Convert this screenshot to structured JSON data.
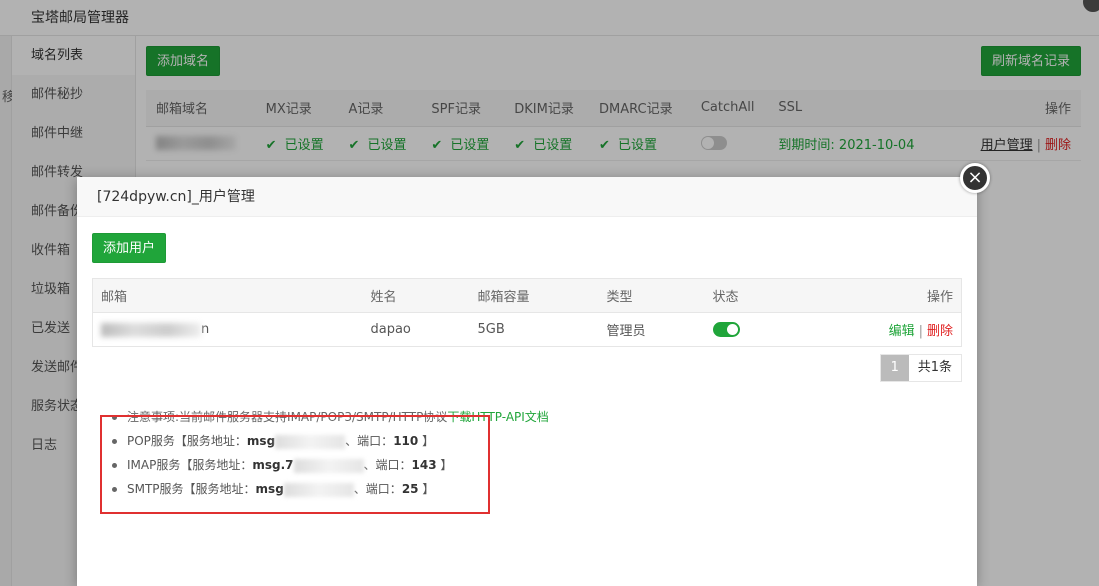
{
  "app": {
    "title": "宝塔邮局管理器",
    "left_stub_label": "移"
  },
  "sidebar": {
    "items": [
      {
        "label": "域名列表"
      },
      {
        "label": "邮件秘抄"
      },
      {
        "label": "邮件中继"
      },
      {
        "label": "邮件转发"
      },
      {
        "label": "邮件备份"
      },
      {
        "label": "收件箱"
      },
      {
        "label": "垃圾箱"
      },
      {
        "label": "已发送"
      },
      {
        "label": "发送邮件"
      },
      {
        "label": "服务状态"
      },
      {
        "label": "日志"
      }
    ]
  },
  "main": {
    "add_domain_label": "添加域名",
    "refresh_label": "刷新域名记录",
    "columns": [
      "邮箱域名",
      "MX记录",
      "A记录",
      "SPF记录",
      "DKIM记录",
      "DMARC记录",
      "CatchAll",
      "SSL",
      "操作"
    ],
    "row": {
      "mx": "已设置",
      "a": "已设置",
      "spf": "已设置",
      "dkim": "已设置",
      "dmarc": "已设置",
      "ssl": "到期时间: 2021-10-04",
      "manage": "用户管理",
      "delete": "删除"
    }
  },
  "modal": {
    "title": "[724dpyw.cn]_用户管理",
    "close_symbol": "×",
    "add_user_label": "添加用户",
    "columns": [
      "邮箱",
      "姓名",
      "邮箱容量",
      "类型",
      "状态",
      "操作"
    ],
    "rows": [
      {
        "email_suffix": "n",
        "name": "dapao",
        "quota": "5GB",
        "type": "管理员",
        "edit": "编辑",
        "delete": "删除"
      }
    ],
    "pager": {
      "page": "1",
      "total": "共1条"
    },
    "notes": {
      "warning_text": "注意事项:当前邮件服务器支持IMAP/POP3/SMTP/HTTP协议",
      "warning_link": "下载HTTP-API文档",
      "pop": {
        "prefix": "POP服务【服务地址：",
        "host": "msg",
        "port_label": "、端口：",
        "port": "110",
        "suffix": "】"
      },
      "imap": {
        "prefix": "IMAP服务【服务地址：",
        "host": "msg.7",
        "port_label": "、端口：",
        "port": "143",
        "suffix": "】"
      },
      "smtp": {
        "prefix": "SMTP服务【服务地址：",
        "host": "msg",
        "port_label": "、端口：",
        "port": "25",
        "suffix": "】"
      }
    }
  },
  "colors": {
    "accent_green": "#20a53a",
    "danger_red": "#e02020",
    "highlight_red": "#e03030"
  }
}
